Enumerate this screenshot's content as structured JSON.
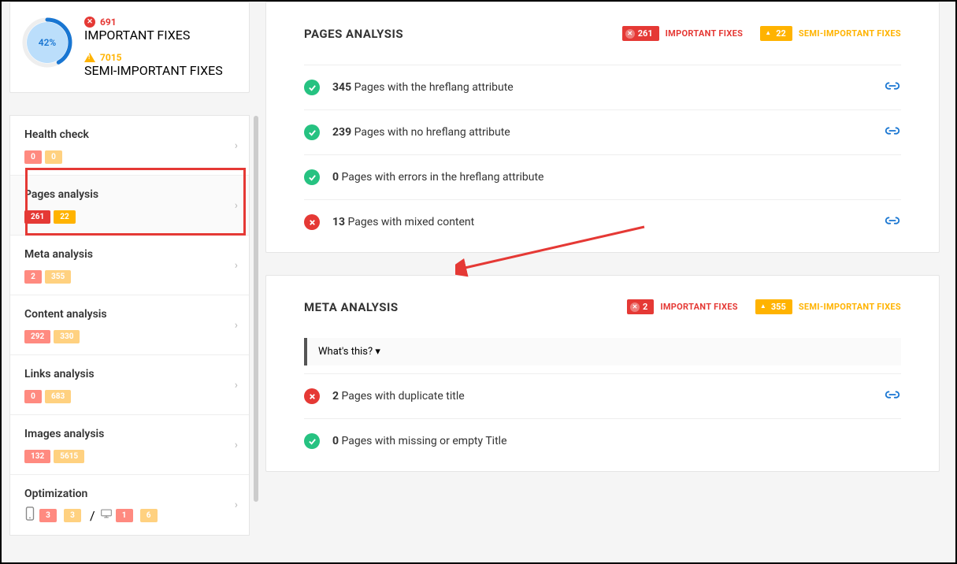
{
  "summary": {
    "health_percent": "42%",
    "important_count": "691",
    "important_label": "IMPORTANT FIXES",
    "semi_important_count": "7015",
    "semi_important_label": "SEMI-IMPORTANT FIXES"
  },
  "nav": [
    {
      "title": "Health check",
      "badges": [
        {
          "cls": "badge-red-soft",
          "v": "0"
        },
        {
          "cls": "badge-orange-soft",
          "v": "0"
        }
      ],
      "active": false
    },
    {
      "title": "Pages analysis",
      "badges": [
        {
          "cls": "badge-red",
          "v": "261"
        },
        {
          "cls": "badge-orange",
          "v": "22"
        }
      ],
      "active": true
    },
    {
      "title": "Meta analysis",
      "badges": [
        {
          "cls": "badge-red-soft",
          "v": "2"
        },
        {
          "cls": "badge-orange-soft",
          "v": "355"
        }
      ],
      "active": false
    },
    {
      "title": "Content analysis",
      "badges": [
        {
          "cls": "badge-red-soft",
          "v": "292"
        },
        {
          "cls": "badge-orange-soft",
          "v": "330"
        }
      ],
      "active": false
    },
    {
      "title": "Links analysis",
      "badges": [
        {
          "cls": "badge-red-soft",
          "v": "0"
        },
        {
          "cls": "badge-orange-soft",
          "v": "683"
        }
      ],
      "active": false
    },
    {
      "title": "Images analysis",
      "badges": [
        {
          "cls": "badge-red-soft",
          "v": "132"
        },
        {
          "cls": "badge-orange-soft",
          "v": "5615"
        }
      ],
      "active": false
    },
    {
      "title": "Optimization",
      "devices": {
        "mobile": [
          {
            "cls": "badge-red-soft",
            "v": "3"
          },
          {
            "cls": "badge-orange-soft",
            "v": "3"
          }
        ],
        "sep": "/",
        "desktop": [
          {
            "cls": "badge-red-soft",
            "v": "1"
          },
          {
            "cls": "badge-orange-soft",
            "v": "6"
          }
        ]
      },
      "active": false
    }
  ],
  "panels": {
    "pages": {
      "title": "PAGES ANALYSIS",
      "important_count": "261",
      "important_label": "IMPORTANT FIXES",
      "semi_count": "22",
      "semi_label": "SEMI-IMPORTANT FIXES",
      "issues": [
        {
          "status": "ok",
          "count": "345",
          "text": "Pages with the hreflang attribute",
          "link": true
        },
        {
          "status": "ok",
          "count": "239",
          "text": "Pages with no hreflang attribute",
          "link": true
        },
        {
          "status": "ok",
          "count": "0",
          "text": "Pages with errors in the hreflang attribute",
          "link": false
        },
        {
          "status": "err",
          "count": "13",
          "text": "Pages with mixed content",
          "link": true
        }
      ]
    },
    "meta": {
      "title": "META ANALYSIS",
      "important_count": "2",
      "important_label": "IMPORTANT FIXES",
      "semi_count": "355",
      "semi_label": "SEMI-IMPORTANT FIXES",
      "whats_this": "What's this? ▾",
      "issues": [
        {
          "status": "err",
          "count": "2",
          "text": "Pages with duplicate title",
          "link": true
        },
        {
          "status": "ok",
          "count": "0",
          "text": "Pages with missing or empty Title",
          "link": false
        }
      ]
    }
  }
}
